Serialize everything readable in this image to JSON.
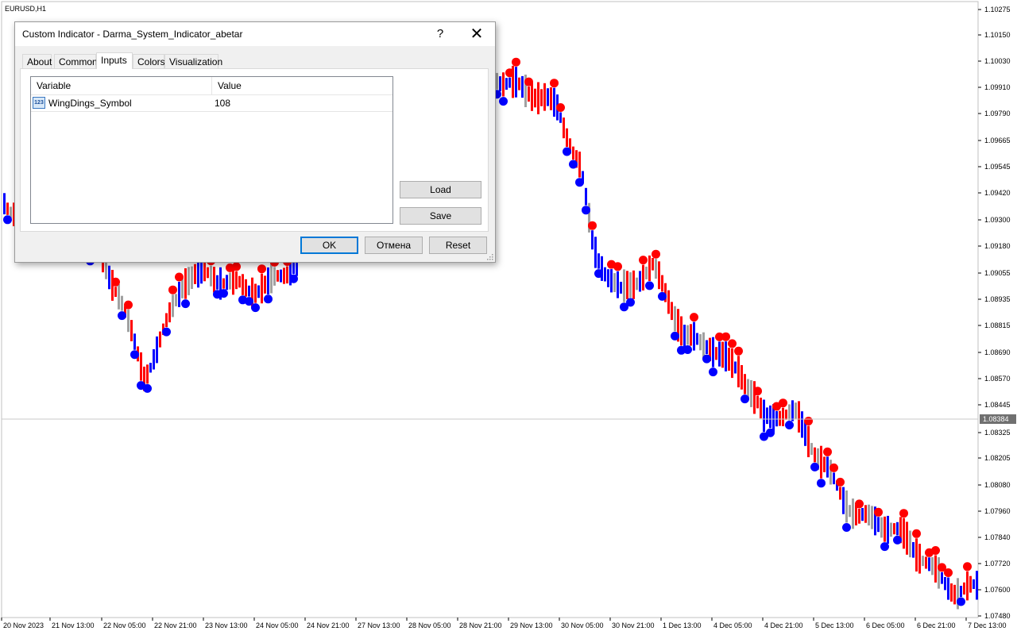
{
  "chart": {
    "symbol_label": "EURUSD,H1",
    "current_price": "1.08384",
    "colors": {
      "up": "#0000ff",
      "down": "#ff0000",
      "neutral": "#a0a0a0",
      "grid": "#c0c0c0"
    },
    "price_labels": [
      "1.10275",
      "1.10150",
      "1.10030",
      "1.09910",
      "1.09790",
      "1.09665",
      "1.09545",
      "1.09420",
      "1.09300",
      "1.09180",
      "1.09055",
      "1.08935",
      "1.08815",
      "1.08690",
      "1.08570",
      "1.08445",
      "1.08325",
      "1.08205",
      "1.08080",
      "1.07960",
      "1.07840",
      "1.07720",
      "1.07600",
      "1.07480"
    ],
    "time_labels": [
      "20 Nov 2023",
      "21 Nov 13:00",
      "22 Nov 05:00",
      "22 Nov 21:00",
      "23 Nov 13:00",
      "24 Nov 05:00",
      "24 Nov 21:00",
      "27 Nov 13:00",
      "28 Nov 05:00",
      "28 Nov 21:00",
      "29 Nov 13:00",
      "30 Nov 05:00",
      "30 Nov 21:00",
      "1 Dec 13:00",
      "4 Dec 05:00",
      "4 Dec 21:00",
      "5 Dec 13:00",
      "6 Dec 05:00",
      "6 Dec 21:00",
      "7 Dec 13:00"
    ]
  },
  "dialog": {
    "title": "Custom Indicator - Darma_System_Indicator_abetar",
    "help_icon": "?",
    "close_icon": "✕",
    "tabs": [
      {
        "label": "About"
      },
      {
        "label": "Common"
      },
      {
        "label": "Inputs",
        "active": true
      },
      {
        "label": "Colors"
      },
      {
        "label": "Visualization"
      }
    ],
    "grid": {
      "col_variable": "Variable",
      "col_value": "Value",
      "rows": [
        {
          "icon": "integer-icon",
          "icon_text": "123",
          "variable": "WingDings_Symbol",
          "value": "108"
        }
      ]
    },
    "load_label": "Load",
    "save_label": "Save",
    "ok_label": "OK",
    "cancel_label": "Отмена",
    "reset_label": "Reset"
  }
}
